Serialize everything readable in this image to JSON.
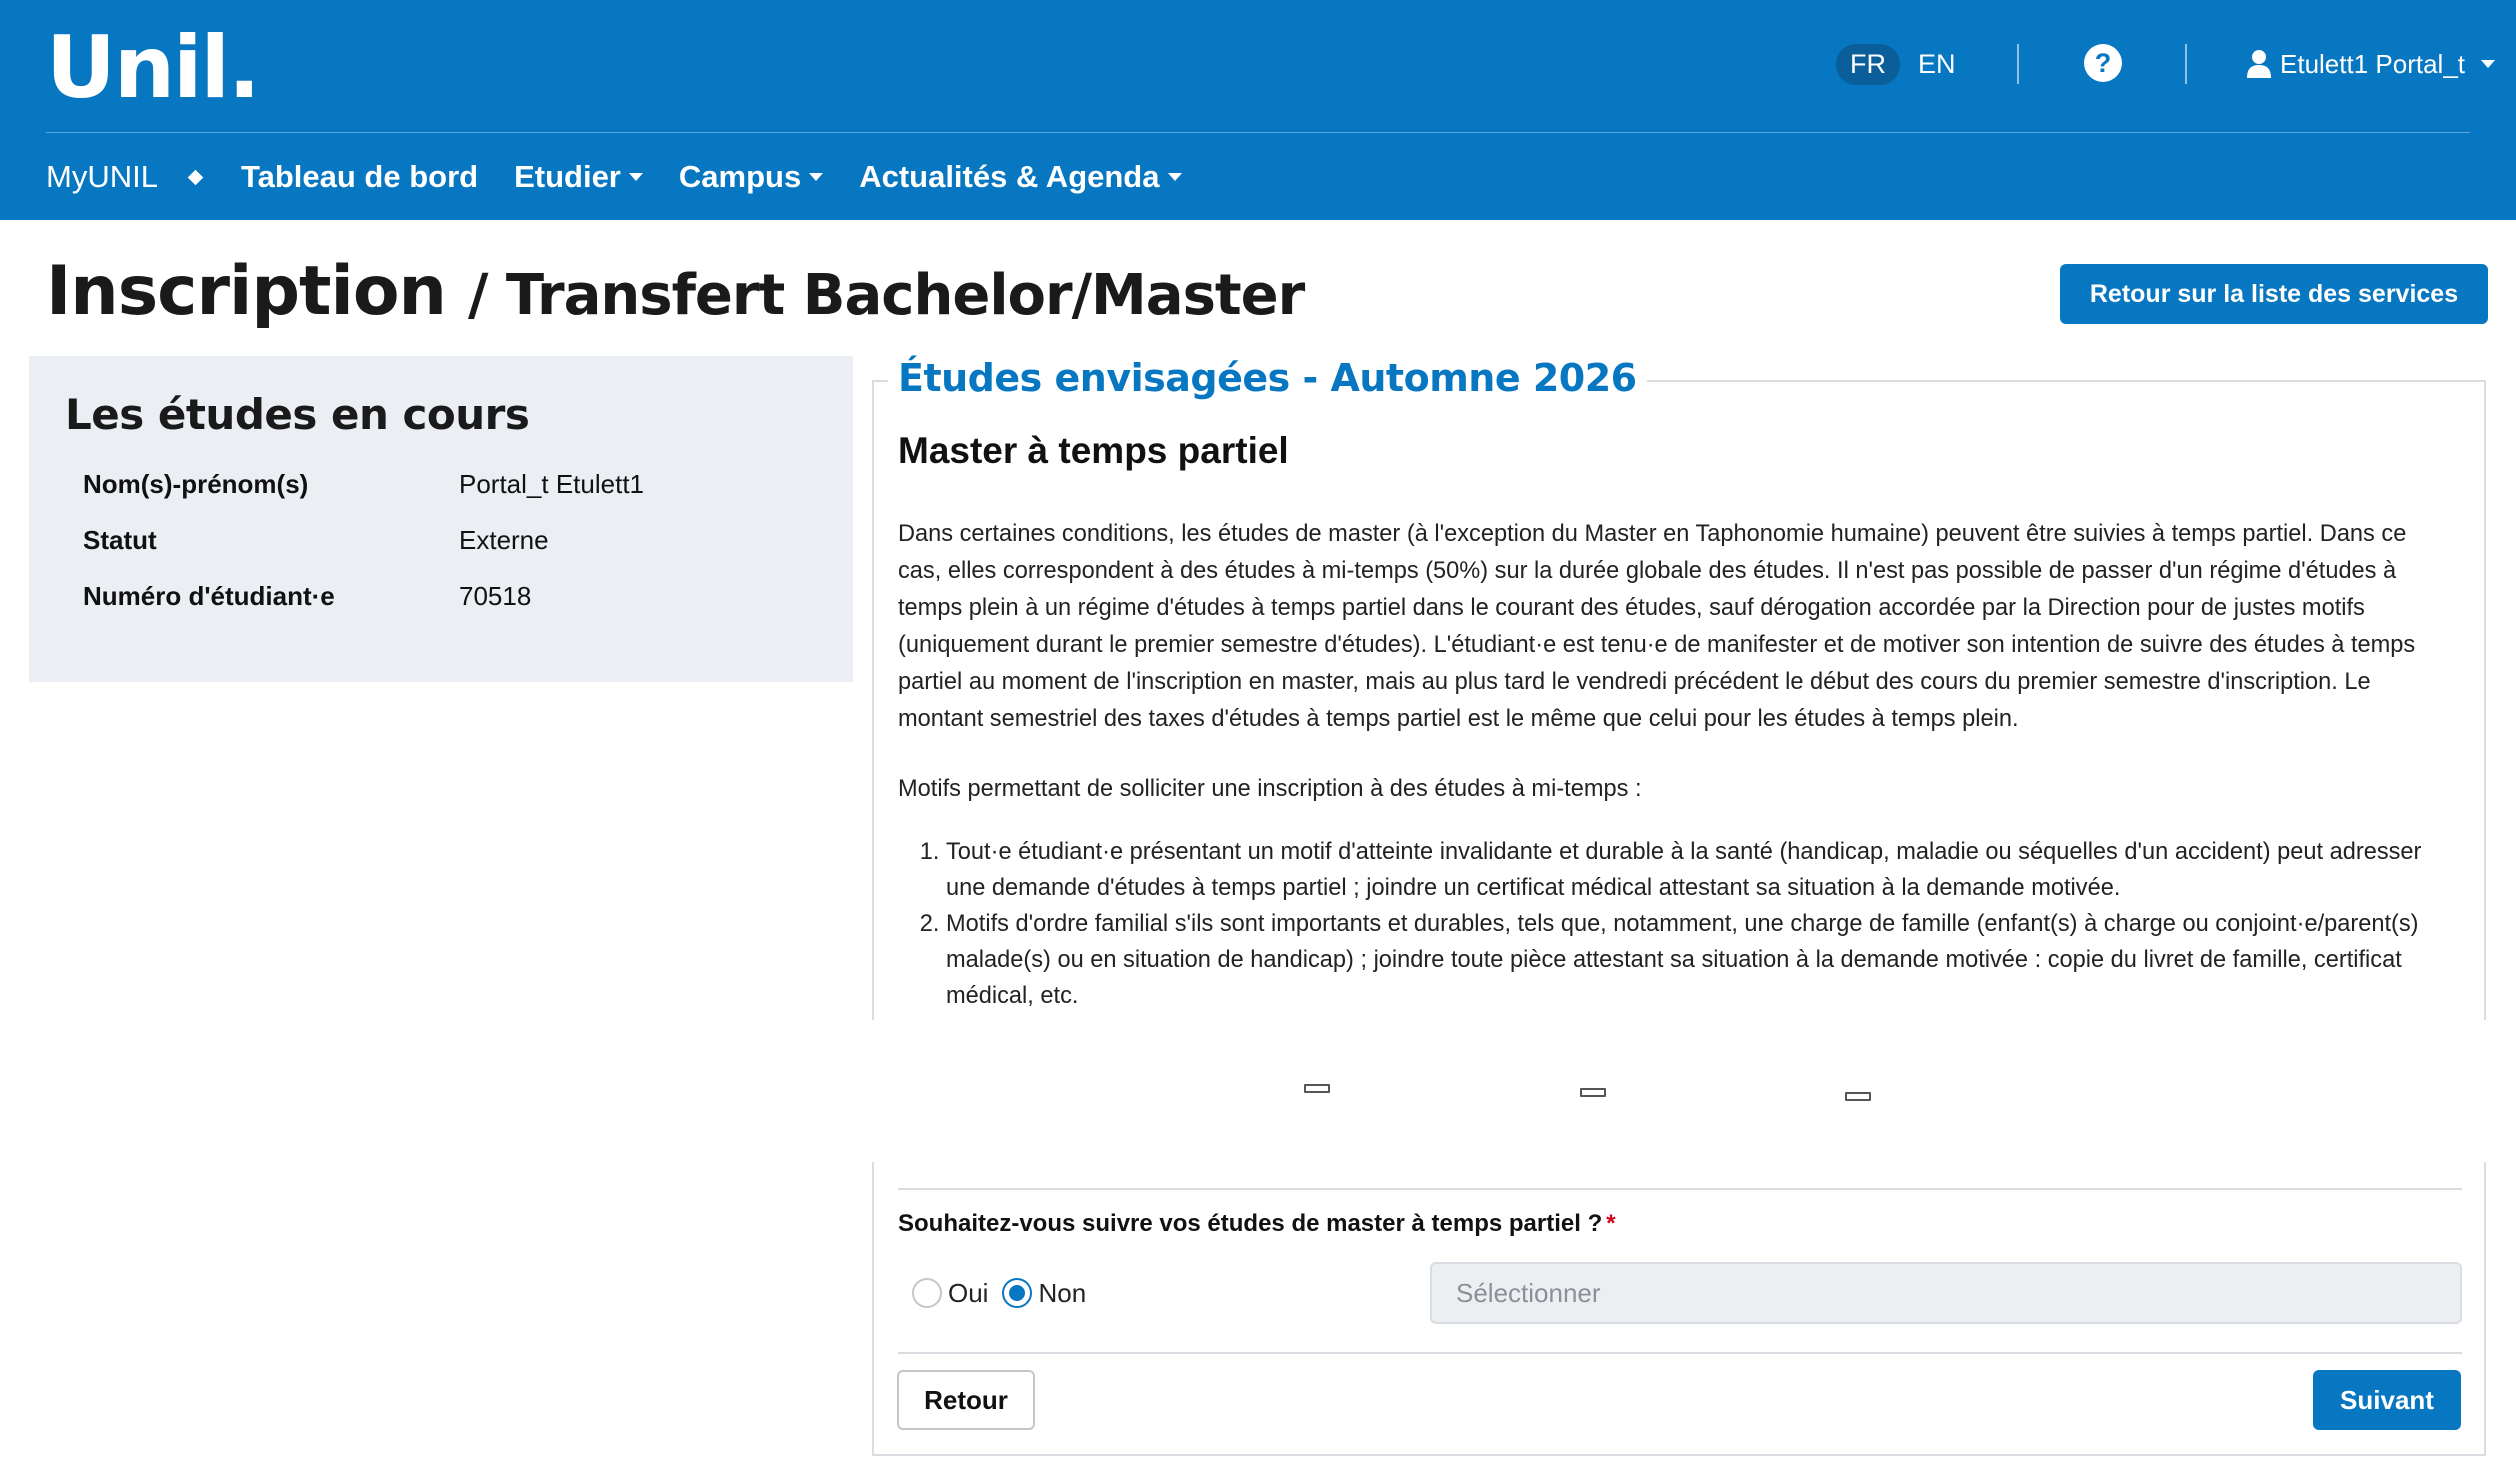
{
  "header": {
    "logo": "Unil",
    "logo_dot": ".",
    "lang_fr": "FR",
    "lang_en": "EN",
    "help": "?",
    "user_name": "Etulett1 Portal_t"
  },
  "nav": {
    "home": "MyUNIL",
    "items": [
      {
        "label": "Tableau de bord",
        "dropdown": false
      },
      {
        "label": "Etudier",
        "dropdown": true
      },
      {
        "label": "Campus",
        "dropdown": true
      },
      {
        "label": "Actualités & Agenda",
        "dropdown": true
      }
    ]
  },
  "page": {
    "title": "Inscription",
    "subtitle": "/ Transfert Bachelor/Master",
    "back_services_label": "Retour sur la liste des services"
  },
  "current_studies": {
    "heading": "Les études en cours",
    "rows": [
      {
        "label": "Nom(s)-prénom(s)",
        "value": "Portal_t Etulett1"
      },
      {
        "label": "Statut",
        "value": "Externe"
      },
      {
        "label": "Numéro d'étudiant·e",
        "value": "70518"
      }
    ]
  },
  "planned_studies": {
    "legend": "Études envisagées - Automne 2026",
    "section_title": "Master à temps partiel",
    "intro": "Dans certaines conditions, les études de master (à l'exception du Master en Taphonomie humaine) peuvent être suivies à temps partiel. Dans ce cas, elles correspondent à des études à mi-temps (50%) sur la durée globale des études. Il n'est pas possible de passer d'un régime d'études à temps plein à un régime d'études à temps partiel dans le courant des études, sauf dérogation accordée par la Direction pour de justes motifs (uniquement durant le premier semestre d'études). L'étudiant·e est tenu·e de manifester et de motiver son intention de suivre des études à temps partiel au moment de l'inscription en master, mais au plus tard le vendredi précédent le début des cours du premier semestre d'inscription. Le montant semestriel des taxes d'études à temps partiel est le même que celui pour les études à temps plein.",
    "motifs_title": "Motifs permettant de solliciter une inscription à des études à mi-temps :",
    "motifs": [
      "Tout·e étudiant·e présentant un motif d'atteinte invalidante et durable à la santé (handicap, maladie ou séquelles d'un accident) peut adresser une demande d'études à temps partiel ; joindre un certificat médical attestant sa situation à la demande motivée.",
      "Motifs d'ordre familial s'ils sont importants et durables, tels que, notamment, une charge de famille (enfant(s) à charge ou conjoint·e/parent(s) malade(s) ou en situation de handicap) ; joindre toute pièce attestant sa situation à la demande motivée : copie du livret de famille, certificat médical, etc."
    ]
  },
  "form": {
    "question": "Souhaitez-vous suivre vos études de master à temps partiel ?",
    "required_mark": "*",
    "option_yes": "Oui",
    "option_no": "Non",
    "selected": "Non",
    "select_placeholder": "Sélectionner",
    "back_label": "Retour",
    "next_label": "Suivant"
  },
  "colors": {
    "brand": "#0777c1",
    "required": "#d0021b"
  }
}
